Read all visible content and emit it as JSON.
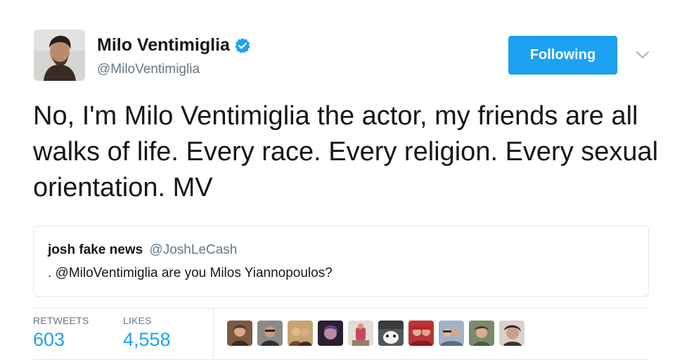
{
  "author": {
    "name": "Milo Ventimiglia",
    "handle": "@MiloVentimiglia",
    "verified": true
  },
  "follow_button": {
    "label": "Following"
  },
  "tweet": {
    "text": "No, I'm Milo Ventimiglia the actor, my friends are all walks of life. Every race. Every religion. Every sexual orientation. MV"
  },
  "quoted_tweet": {
    "name": "josh fake news",
    "handle": "@JoshLeCash",
    "text": ". @MiloVentimiglia are you Milos Yiannopoulos?"
  },
  "stats": {
    "retweets_label": "RETWEETS",
    "retweets_value": "603",
    "likes_label": "LIKES",
    "likes_value": "4,558"
  },
  "colors": {
    "accent": "#1da1f2",
    "muted": "#657786",
    "border": "#e1e8ed"
  },
  "likers_count": 10
}
